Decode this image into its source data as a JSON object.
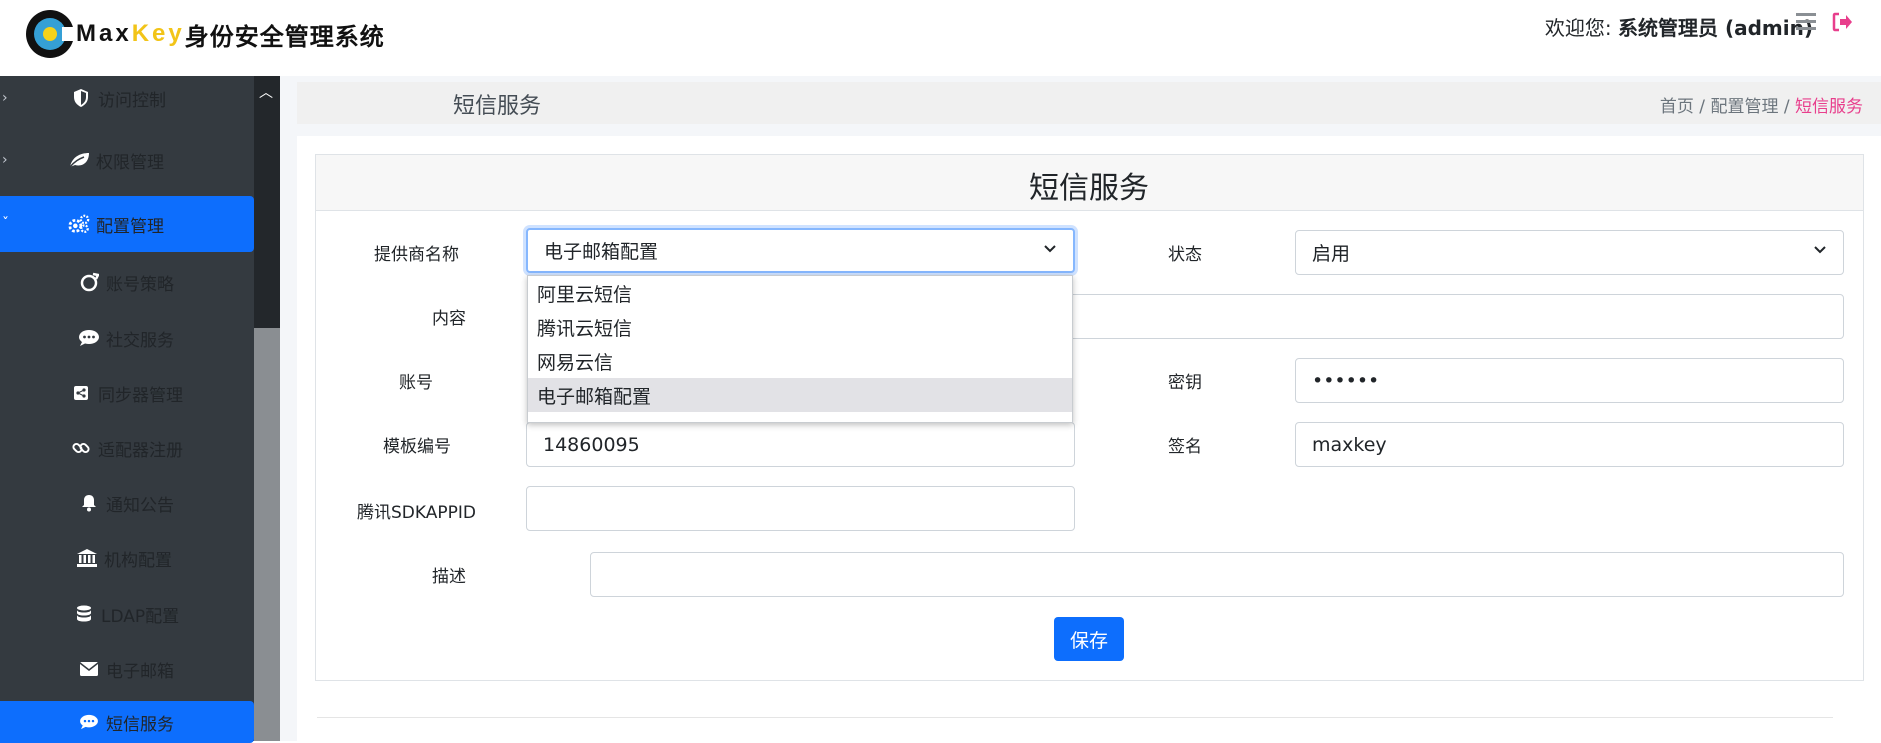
{
  "header": {
    "logo_max": "Max",
    "logo_key": "Key",
    "logo_title": "身份安全管理系统",
    "welcome": "欢迎您:",
    "user_name": "系统管理员 (admin)",
    "menu_icon": "hamburger-icon",
    "logout_icon": "sign-out-icon"
  },
  "sidebar": {
    "items": [
      {
        "label": "访问控制",
        "icon": "shield-icon"
      },
      {
        "label": "权限管理",
        "icon": "leaf-icon"
      },
      {
        "label": "配置管理",
        "icon": "gears-icon",
        "active": true
      },
      {
        "label": "账号策略",
        "icon": "circle-icon"
      },
      {
        "label": "社交服务",
        "icon": "comment-dots-icon"
      },
      {
        "label": "同步器管理",
        "icon": "share-square-icon"
      },
      {
        "label": "适配器注册",
        "icon": "link-icon"
      },
      {
        "label": "通知公告",
        "icon": "bell-icon"
      },
      {
        "label": "机构配置",
        "icon": "bank-icon"
      },
      {
        "label": "LDAP配置",
        "icon": "database-icon"
      },
      {
        "label": "电子邮箱",
        "icon": "envelope-icon"
      },
      {
        "label": "短信服务",
        "icon": "comment-dots-icon",
        "active": true
      }
    ]
  },
  "page": {
    "title": "短信服务",
    "breadcrumb": {
      "home": "首页",
      "sep": " / ",
      "parent": "配置管理",
      "current": "短信服务"
    },
    "card_title": "短信服务"
  },
  "form": {
    "provider_label": "提供商名称",
    "provider_value": "电子邮箱配置",
    "provider_options": [
      "阿里云短信",
      "腾讯云短信",
      "网易云信",
      "电子邮箱配置"
    ],
    "status_label": "状态",
    "status_value": "启用",
    "content_label": "内容",
    "account_label": "账号",
    "secret_label": "密钥",
    "secret_value": "••••••",
    "template_label": "模板编号",
    "template_value": "14860095",
    "sign_label": "签名",
    "sign_value": "maxkey",
    "sdkappid_label": "腾讯SDKAPPID",
    "sdkappid_value": "",
    "desc_label": "描述",
    "desc_value": "",
    "save_label": "保存"
  },
  "colors": {
    "primary": "#0d6efd",
    "sidebar": "#343a40",
    "breadcrumb_current": "#e83e8c",
    "logo_key": "#f2c418"
  }
}
